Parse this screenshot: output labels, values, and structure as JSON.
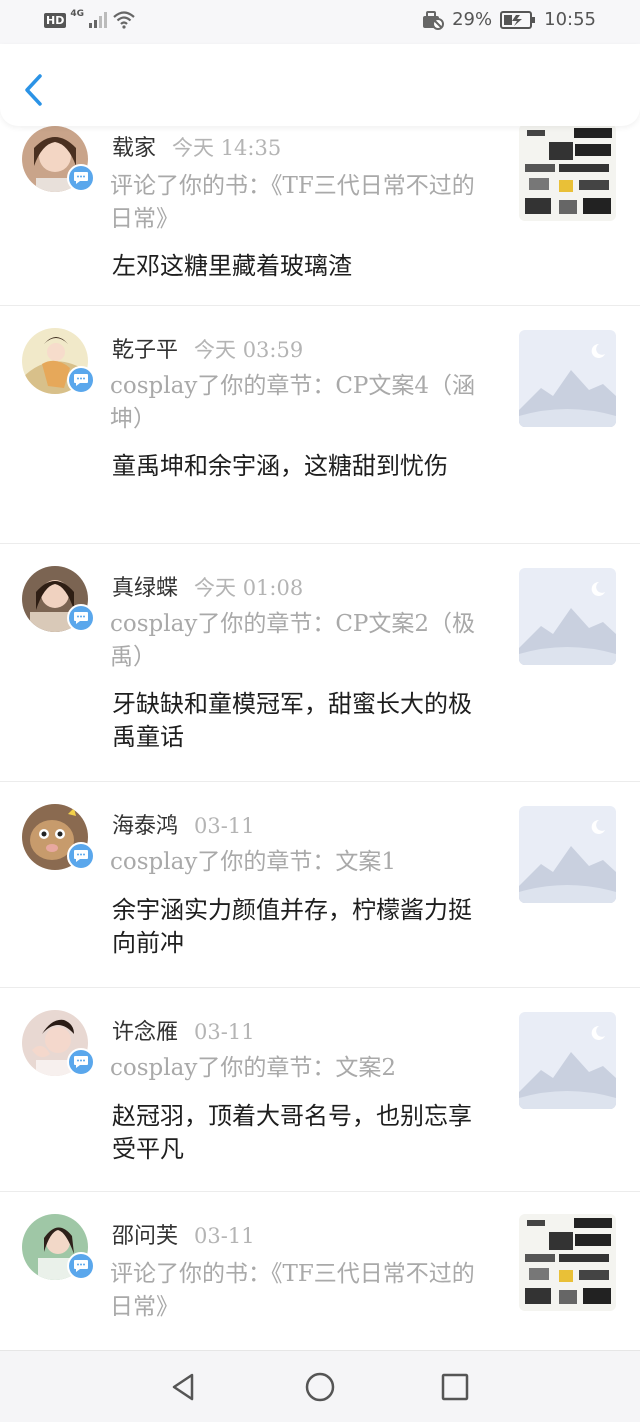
{
  "status_bar": {
    "left_label": "HD",
    "network_label": "4G",
    "battery_percent": "29%",
    "time": "10:55",
    "icons": [
      "signal-icon",
      "wifi-icon",
      "alarm-icon",
      "battery-icon"
    ]
  },
  "header": {
    "back_icon": "chevron-left-icon",
    "accent": "#2b93e6"
  },
  "notifications": [
    {
      "name": "载家",
      "time": "今天 14:35",
      "action": "评论了你的书：《TF三代日常不过的日常》",
      "comment": "左邓这糖里藏着玻璃渣",
      "thumb": "book-cover"
    },
    {
      "name": "乾子平",
      "time": "今天 03:59",
      "action": "cosplay了你的章节：CP文案4（涵坤）",
      "comment": "童禹坤和余宇涵，这糖甜到忧伤",
      "thumb": "placeholder"
    },
    {
      "name": "真绿蝶",
      "time": "今天 01:08",
      "action": "cosplay了你的章节：CP文案2（极禹）",
      "comment": "牙缺缺和童模冠军，甜蜜长大的极禹童话",
      "thumb": "placeholder"
    },
    {
      "name": "海泰鸿",
      "time": "03-11",
      "action": "cosplay了你的章节：文案1",
      "comment": "余宇涵实力颜值并存，柠檬酱力挺向前冲",
      "thumb": "placeholder"
    },
    {
      "name": "许念雁",
      "time": "03-11",
      "action": "cosplay了你的章节：文案2",
      "comment": "赵冠羽，顶着大哥名号，也别忘享受平凡",
      "thumb": "placeholder"
    },
    {
      "name": "邵问芙",
      "time": "03-11",
      "action": "评论了你的书：《TF三代日常不过的日常》",
      "comment": "",
      "thumb": "book-cover"
    }
  ],
  "navbar": {
    "icons": [
      "back-triangle-icon",
      "home-circle-icon",
      "recents-square-icon"
    ]
  },
  "colors": {
    "badge": "#5aa7ec",
    "muted_text": "#a9a9a9",
    "divider": "#ececec"
  }
}
